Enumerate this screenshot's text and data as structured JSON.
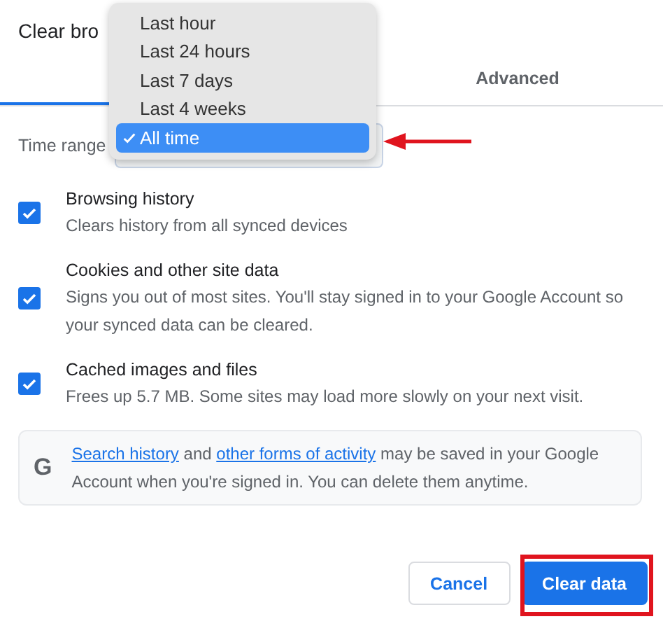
{
  "dialog": {
    "title": "Clear bro"
  },
  "tabs": [
    {
      "selected": true
    },
    {
      "label": "Advanced",
      "selected": false
    }
  ],
  "time_range": {
    "label": "Time range"
  },
  "menu": {
    "options": [
      {
        "label": "Last hour",
        "selected": false
      },
      {
        "label": "Last 24 hours",
        "selected": false
      },
      {
        "label": "Last 7 days",
        "selected": false
      },
      {
        "label": "Last 4 weeks",
        "selected": false
      },
      {
        "label": "All time",
        "selected": true
      }
    ]
  },
  "items": [
    {
      "title": "Browsing history",
      "description": "Clears history from all synced devices",
      "checked": true
    },
    {
      "title": "Cookies and other site data",
      "description": "Signs you out of most sites. You'll stay signed in to your Google Account so your synced data can be cleared.",
      "checked": true
    },
    {
      "title": "Cached images and files",
      "description": "Frees up 5.7 MB. Some sites may load more slowly on your next visit.",
      "checked": true
    }
  ],
  "notice": {
    "icon": "G",
    "parts": [
      {
        "kind": "link",
        "text": "Search history"
      },
      {
        "kind": "text",
        "text": " and "
      },
      {
        "kind": "link",
        "text": "other forms of activity"
      },
      {
        "kind": "text",
        "text": " may be saved in your Google Account when you're signed in. You can delete them anytime."
      }
    ]
  },
  "buttons": [
    {
      "label": "Cancel",
      "kind": "secondary"
    },
    {
      "label": "Clear data",
      "kind": "primary"
    }
  ],
  "annotations": {
    "arrow": true,
    "frame": true
  }
}
